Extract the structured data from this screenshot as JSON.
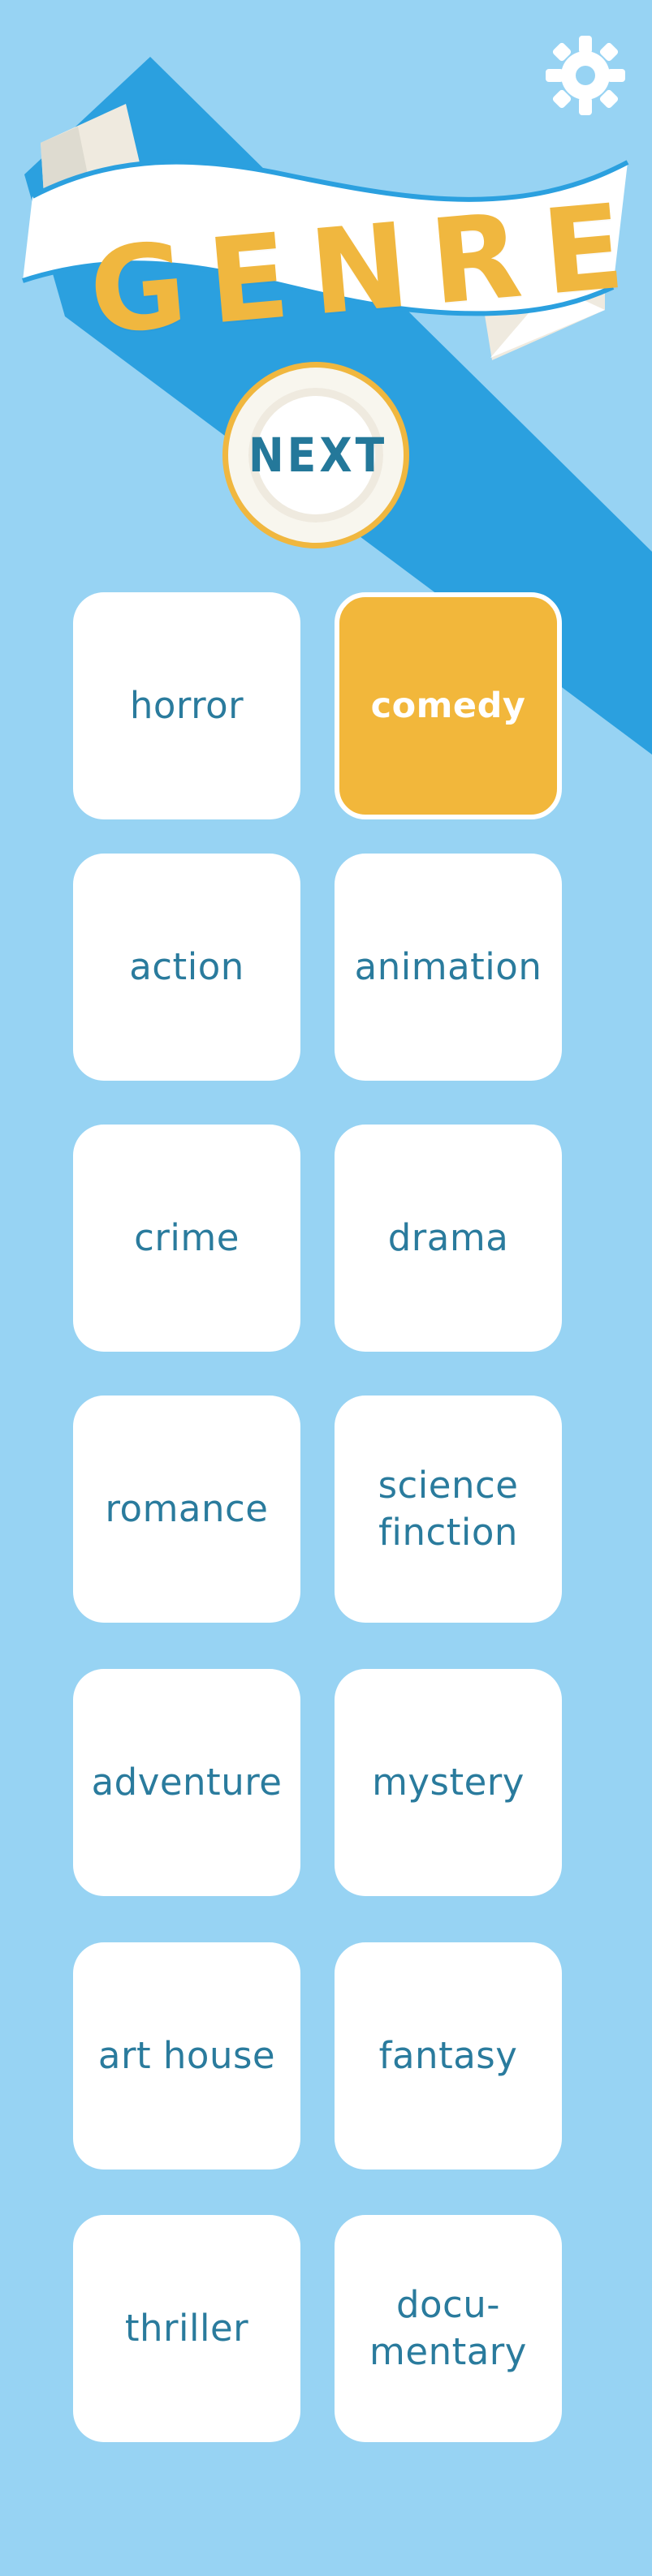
{
  "colors": {
    "background": "#97d3f3",
    "accent_blue": "#2ba0df",
    "accent_yellow": "#f0b73f",
    "card_background": "#ffffff",
    "card_text": "#2a7b9d"
  },
  "header": {
    "title": "GENRE",
    "settings_icon": "gear-icon"
  },
  "next_button": {
    "label": "NEXT"
  },
  "genres": [
    {
      "label": "horror",
      "selected": false
    },
    {
      "label": "comedy",
      "selected": true
    },
    {
      "label": "action",
      "selected": false
    },
    {
      "label": "animation",
      "selected": false
    },
    {
      "label": "crime",
      "selected": false
    },
    {
      "label": "drama",
      "selected": false
    },
    {
      "label": "romance",
      "selected": false
    },
    {
      "label": "science\nfinction",
      "selected": false
    },
    {
      "label": "adventure",
      "selected": false
    },
    {
      "label": "mystery",
      "selected": false
    },
    {
      "label": "art house",
      "selected": false
    },
    {
      "label": "fantasy",
      "selected": false
    },
    {
      "label": "thriller",
      "selected": false
    },
    {
      "label": "docu-\nmentary",
      "selected": false
    }
  ]
}
